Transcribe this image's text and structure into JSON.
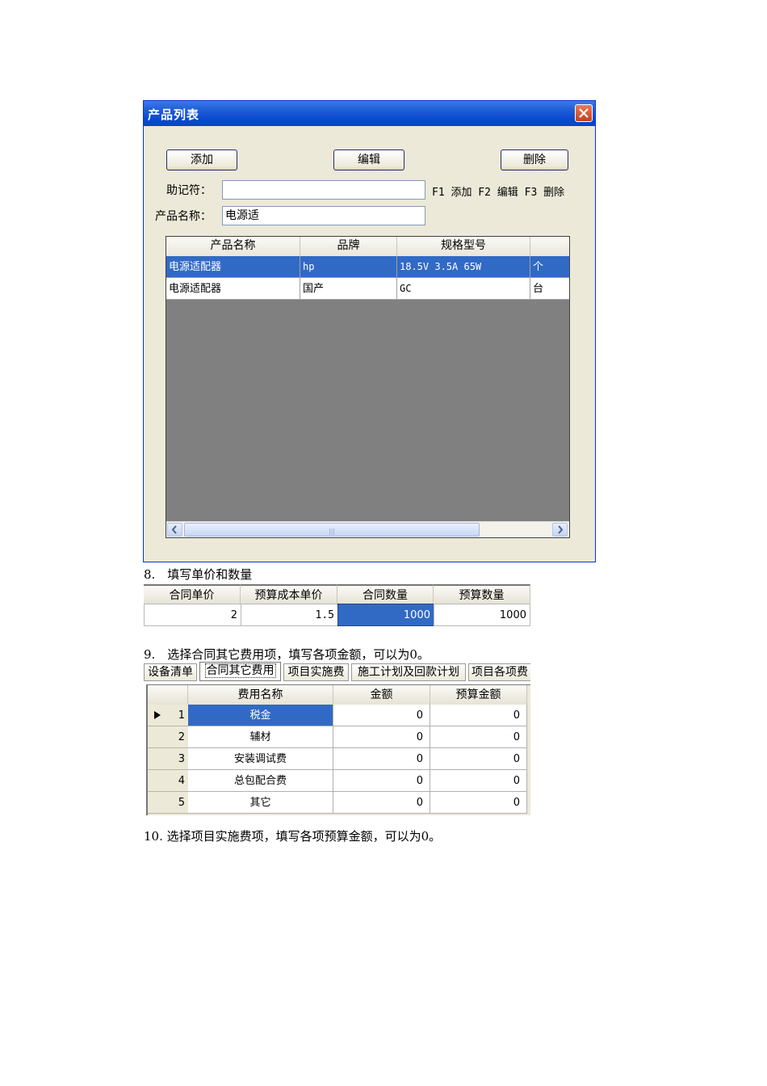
{
  "dialog": {
    "title": "产品列表",
    "buttons": {
      "add": "添加",
      "edit": "编辑",
      "delete": "删除"
    },
    "mnemonic_label": "助记符：",
    "mnemonic_value": "",
    "product_name_label": "产品名称：",
    "product_name_value": "电源适",
    "hint": "F1 添加 F2 编辑 F3 删除",
    "grid": {
      "headers": [
        "产品名称",
        "品牌",
        "规格型号",
        ""
      ],
      "rows": [
        [
          "电源适配器",
          "hp",
          "18.5V 3.5A 65W",
          "个"
        ],
        [
          "电源适配器",
          "国产",
          "GC",
          "台"
        ]
      ],
      "selected_row": 0
    },
    "scroll_grip": "|||"
  },
  "step8": {
    "text": "8.　填写单价和数量",
    "headers": [
      "合同单价",
      "预算成本单价",
      "合同数量",
      "预算数量"
    ],
    "values": [
      "2",
      "1.5",
      "1000",
      "1000"
    ]
  },
  "step9": {
    "text": "9.　选择合同其它费用项，填写各项金额，可以为0。",
    "tabs": [
      "设备清单",
      "合同其它费用",
      "项目实施费",
      "施工计划及回款计划",
      "项目各项费"
    ],
    "active_tab": 1,
    "headers": [
      "费用名称",
      "金额",
      "预算金额"
    ],
    "rows": [
      {
        "idx": "1",
        "name": "税金",
        "amount": "0",
        "budget": "0"
      },
      {
        "idx": "2",
        "name": "辅材",
        "amount": "0",
        "budget": "0"
      },
      {
        "idx": "3",
        "name": "安装调试费",
        "amount": "0",
        "budget": "0"
      },
      {
        "idx": "4",
        "name": "总包配合费",
        "amount": "0",
        "budget": "0"
      },
      {
        "idx": "5",
        "name": "其它",
        "amount": "0",
        "budget": "0"
      }
    ]
  },
  "step10": {
    "text": "10. 选择项目实施费项，填写各项预算金额，可以为0。"
  },
  "colors": {
    "titlebar": "#0a4bd1",
    "selection": "#316ac5",
    "grid_bg": "#808080"
  }
}
